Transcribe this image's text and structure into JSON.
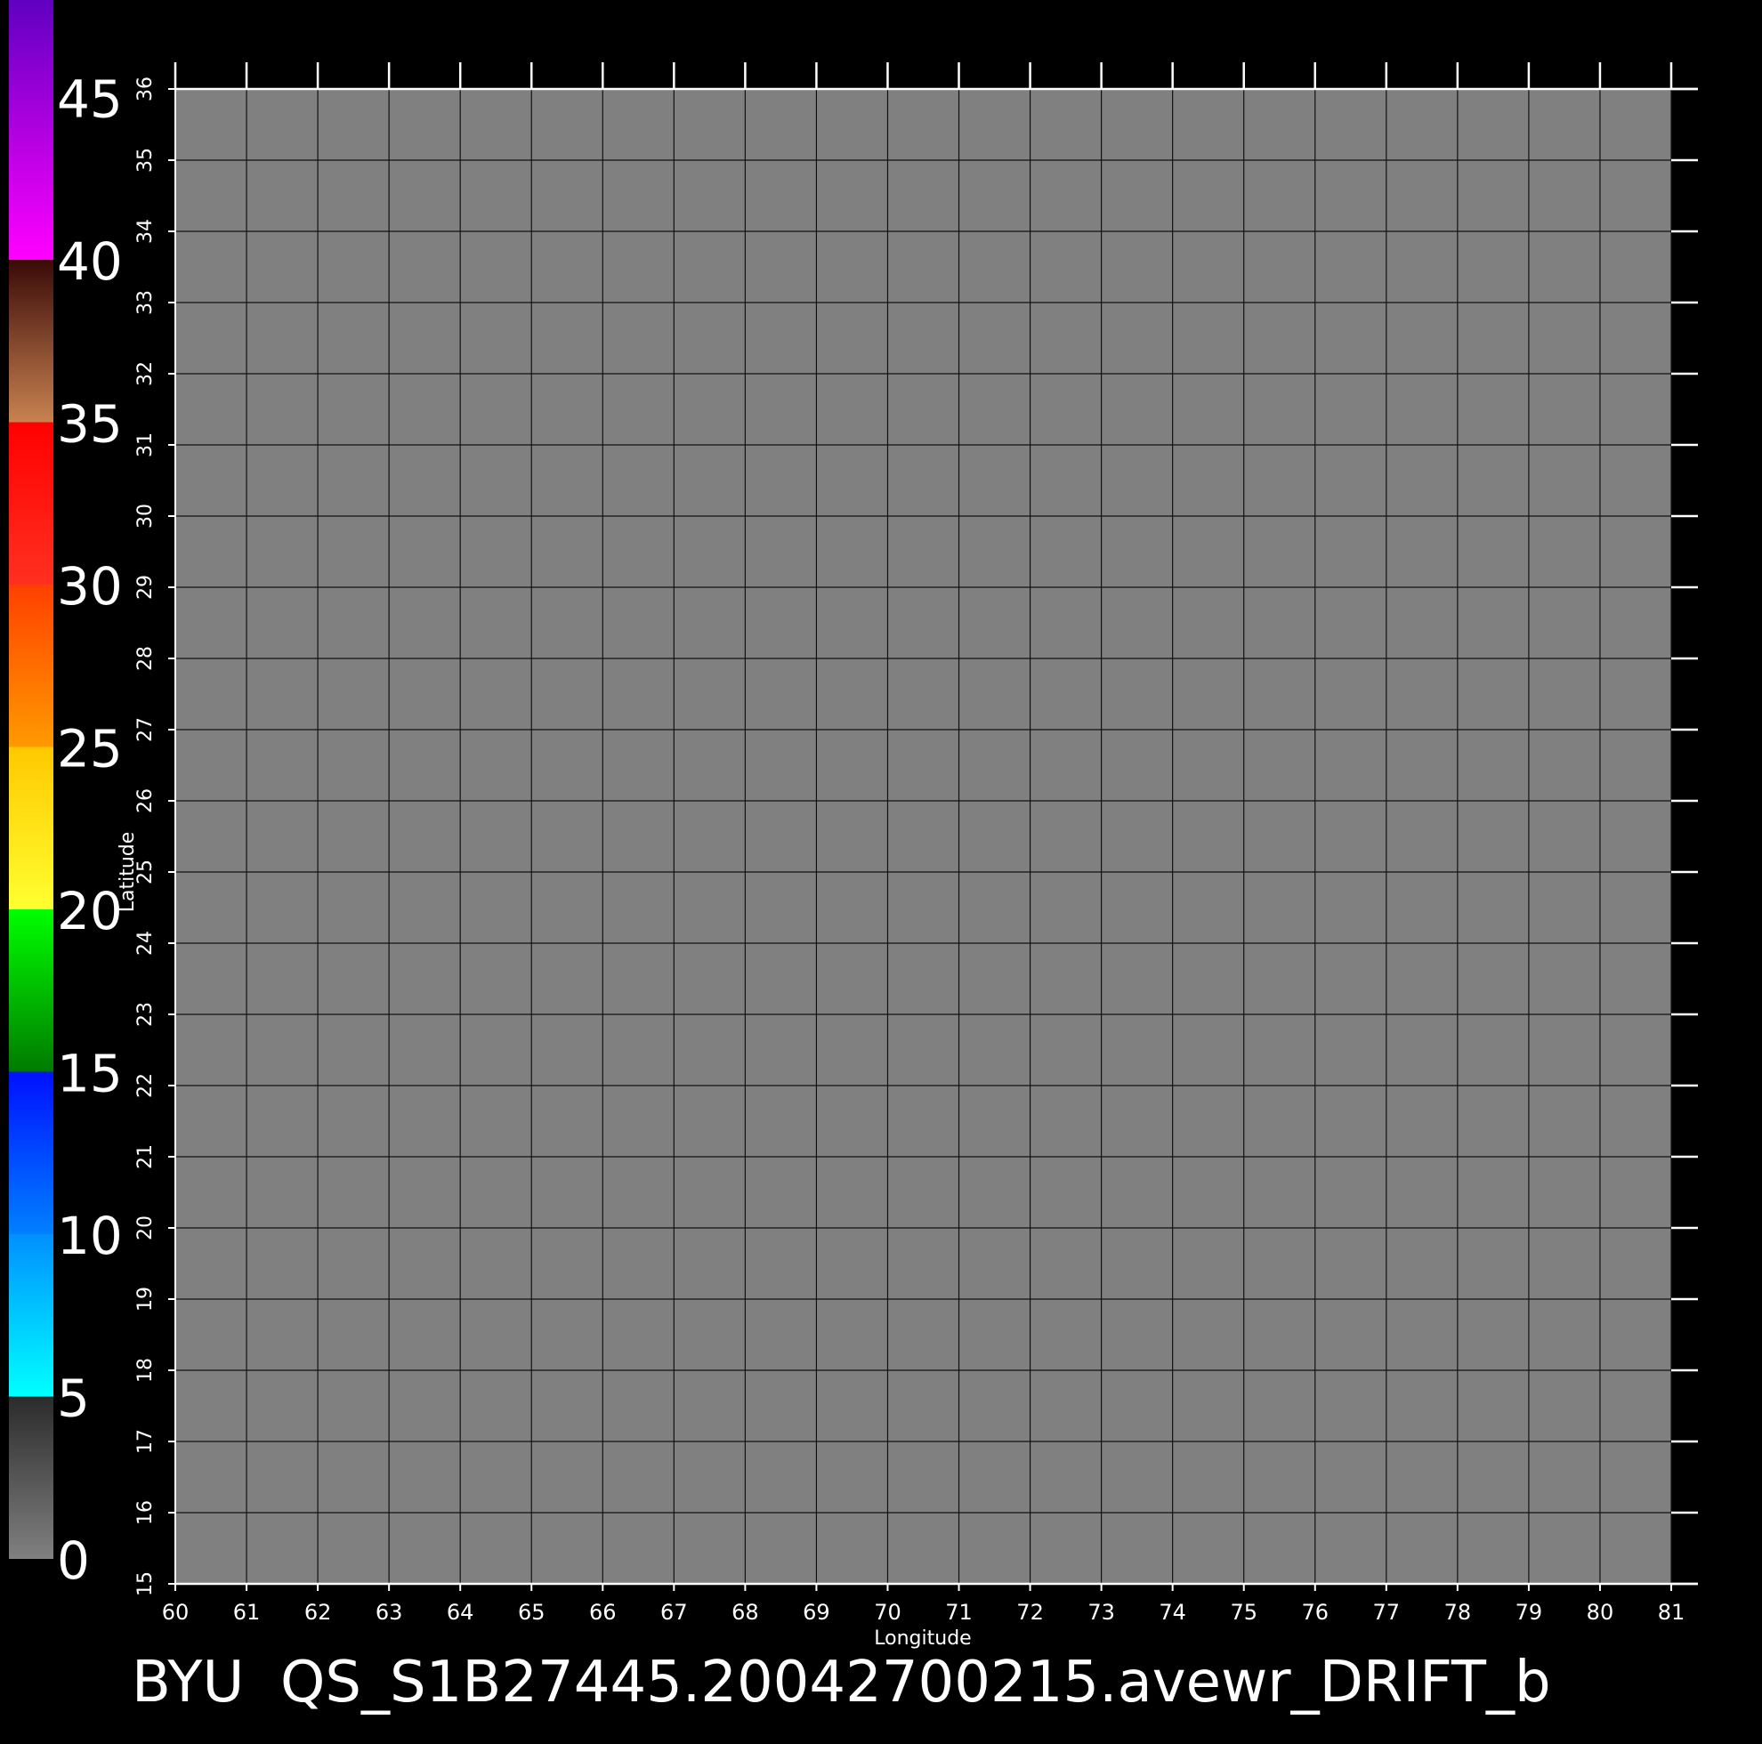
{
  "chart_data": {
    "type": "heatmap",
    "title": "BYU  QS_S1B27445.20042700215.avewr_DRIFT_b",
    "xlabel": "Longitude",
    "ylabel": "Latitude",
    "xlim": [
      60,
      81
    ],
    "ylim": [
      15,
      36
    ],
    "x_ticks": [
      "60",
      "61",
      "62",
      "63",
      "64",
      "65",
      "66",
      "67",
      "68",
      "69",
      "70",
      "71",
      "72",
      "73",
      "74",
      "75",
      "76",
      "77",
      "78",
      "79",
      "80",
      "81"
    ],
    "y_ticks": [
      "15",
      "16",
      "17",
      "18",
      "19",
      "20",
      "21",
      "22",
      "23",
      "24",
      "25",
      "26",
      "27",
      "28",
      "29",
      "30",
      "31",
      "32",
      "33",
      "34",
      "35",
      "36"
    ],
    "grid": true,
    "plot_fill": "#808080",
    "colorbar": {
      "placement": "left",
      "range": [
        0,
        48
      ],
      "tick_labels": [
        "0",
        "5",
        "10",
        "15",
        "20",
        "25",
        "30",
        "35",
        "40",
        "45"
      ],
      "segments": [
        {
          "from": 0,
          "to": 5,
          "colors": [
            "#808080",
            "#2b2b2b"
          ]
        },
        {
          "from": 5,
          "to": 10,
          "colors": [
            "#00ffff",
            "#0090ff"
          ]
        },
        {
          "from": 10,
          "to": 15,
          "colors": [
            "#0080ff",
            "#0010ff"
          ]
        },
        {
          "from": 15,
          "to": 20,
          "colors": [
            "#007a00",
            "#00ff00"
          ]
        },
        {
          "from": 20,
          "to": 25,
          "colors": [
            "#ffff30",
            "#ffc800"
          ]
        },
        {
          "from": 25,
          "to": 30,
          "colors": [
            "#ff9a00",
            "#ff4000"
          ]
        },
        {
          "from": 30,
          "to": 35,
          "colors": [
            "#ff3020",
            "#ff0000"
          ]
        },
        {
          "from": 35,
          "to": 40,
          "colors": [
            "#c88250",
            "#3a0a08"
          ]
        },
        {
          "from": 40,
          "to": 48,
          "colors": [
            "#ff00ff",
            "#6000c0"
          ]
        }
      ]
    }
  }
}
